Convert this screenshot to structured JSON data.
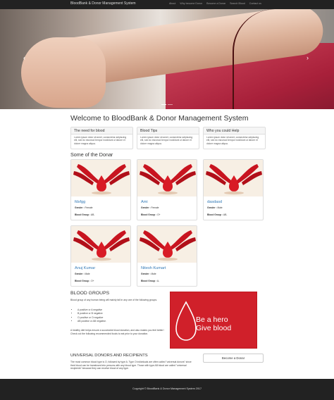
{
  "navbar": {
    "brand": "BloodBank & Donor Management System",
    "links": [
      "About",
      "Why become Donor",
      "Become a Donar",
      "Search Blood",
      "Contact us"
    ]
  },
  "carousel": {
    "prev": "‹",
    "next": "›",
    "slide_count": 2,
    "active_slide": 1
  },
  "page_title": "Welcome to BloodBank & Donor Management System",
  "info_panels": [
    {
      "title": "The need for blood",
      "body": "Lorem ipsum dolor sit amet, consectetur adipiscing elit, sed do eiusmod tempor incididunt ut labore et dolore magna aliqua."
    },
    {
      "title": "Blood Tips",
      "body": "Lorem ipsum dolor sit amet, consectetur adipiscing elit, sed do eiusmod tempor incididunt ut labore et dolore magna aliqua."
    },
    {
      "title": "Who you could Help",
      "body": "Lorem ipsum dolor sit amet, consectetur adipiscing elit, sed do eiusmod tempor incididunt ut labore et dolore magna aliqua."
    }
  ],
  "donors_heading": "Some of the Donar",
  "donor_labels": {
    "gender": "Gender :",
    "blood_group": "Blood Group :"
  },
  "donors": [
    {
      "name": "fdsfgg",
      "gender": "Female",
      "blood_group": "AB-"
    },
    {
      "name": "Ami",
      "gender": "Female",
      "blood_group": "O+"
    },
    {
      "name": "dasdasd",
      "gender": "Male",
      "blood_group": "AB-"
    },
    {
      "name": "Anuj Kumar",
      "gender": "Male",
      "blood_group": "O+"
    },
    {
      "name": "Nitesh Kumart",
      "gender": "Male",
      "blood_group": "A-"
    }
  ],
  "blood_groups": {
    "title": "BLOOD GROUPS",
    "intro": "Blood group of any human being will mainly fall in any one of the following groups.",
    "items": [
      "A positive or A negative",
      "B positive or B negative",
      "O positive or O negative",
      "AB positive or AB negative."
    ],
    "outro": "A healthy diet helps ensure a successful blood donation, and also makes you feel better! Check out the following recommended foods to eat prior to your donation."
  },
  "hero_image": {
    "line1": "Be a hero",
    "line2": "Give blood"
  },
  "universal": {
    "title": "UNIVERSAL DONORS AND RECIPIENTS",
    "body": "The most common blood type is O, followed by type A. Type O individuals are often called \"universal donors\" since their blood can be transfused into persons with any blood type. Those with type AB blood are called \"universal recipients\" because they can receive blood of any type."
  },
  "become_button": "Become a Donar",
  "footer": "Copyright © BloodBank & Donor Management System 2017",
  "colors": {
    "navbar": "#222222",
    "link": "#337ab7",
    "hero_red": "#d0202a"
  }
}
